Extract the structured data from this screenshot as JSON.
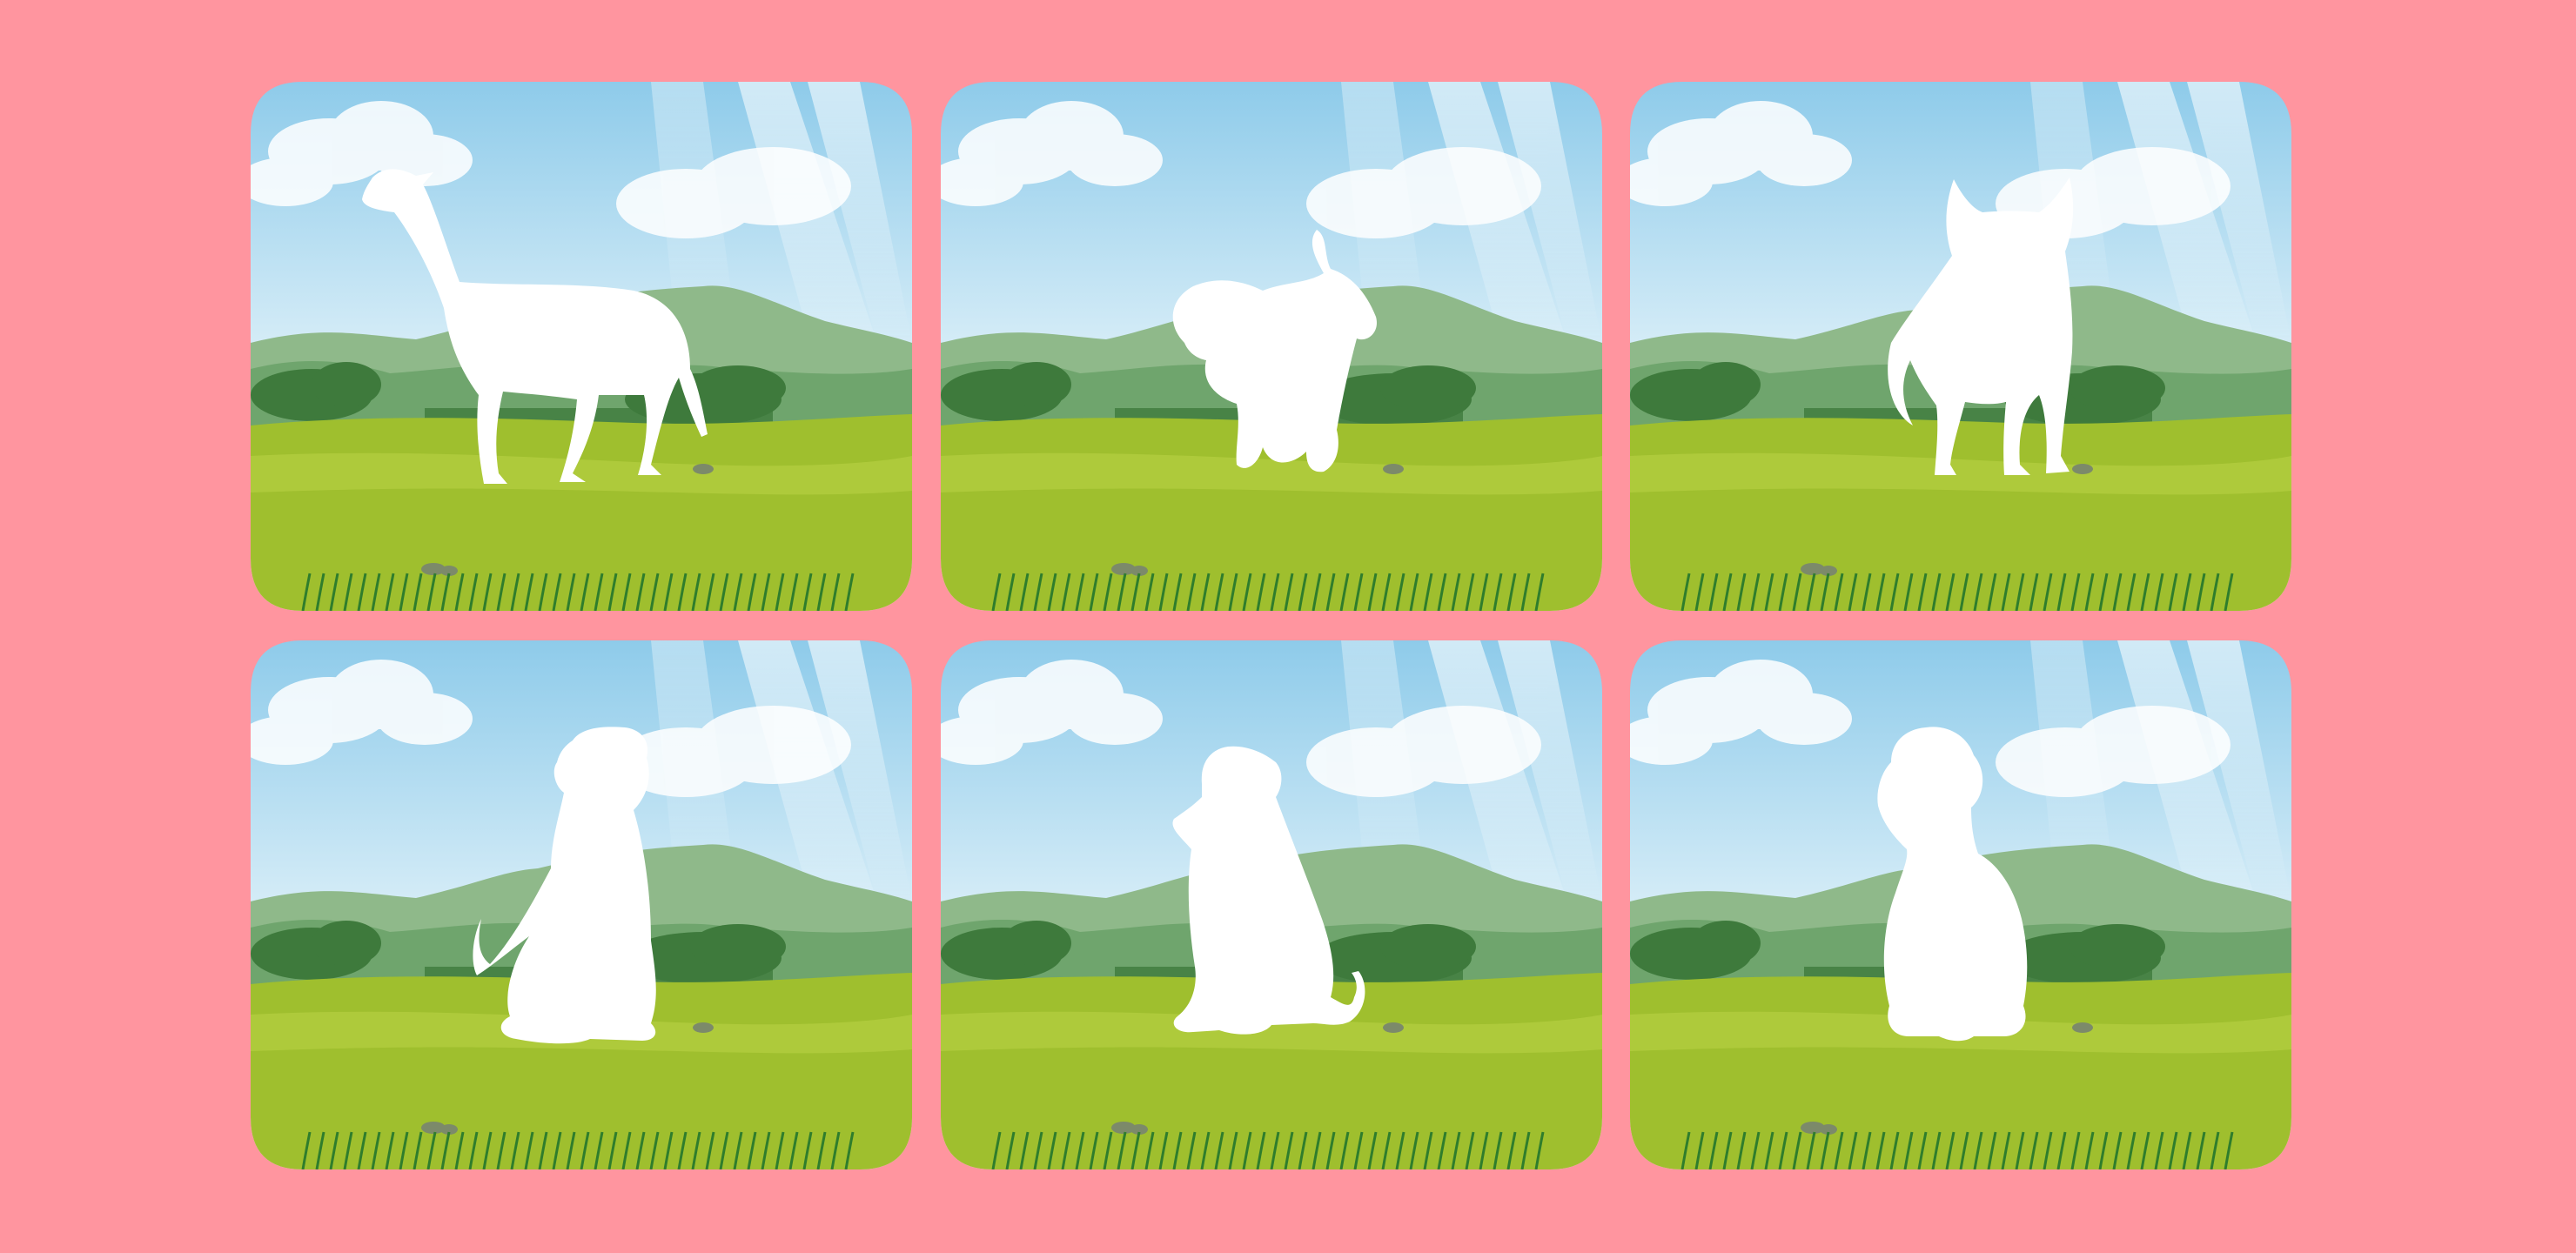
{
  "background_color": "#ff959f",
  "scene": {
    "sky_top": "#8ecbea",
    "sky_bottom": "#eaf6fb",
    "mountain_far": "#8fb98a",
    "mountain_near": "#6fa56d",
    "trees": "#3e7a3c",
    "field": "#9fbf2e",
    "field_light": "#b5cf42",
    "grass_blades": "#2f7d2c",
    "silhouette": "#ffffff"
  },
  "cards": [
    {
      "id": "card-1",
      "silhouette": "greyhound-standing"
    },
    {
      "id": "card-2",
      "silhouette": "spaniel-walking"
    },
    {
      "id": "card-3",
      "silhouette": "terrier-standing"
    },
    {
      "id": "card-4",
      "silhouette": "boxer-sitting"
    },
    {
      "id": "card-5",
      "silhouette": "schnauzer-sitting"
    },
    {
      "id": "card-6",
      "silhouette": "poodle-sitting"
    }
  ]
}
